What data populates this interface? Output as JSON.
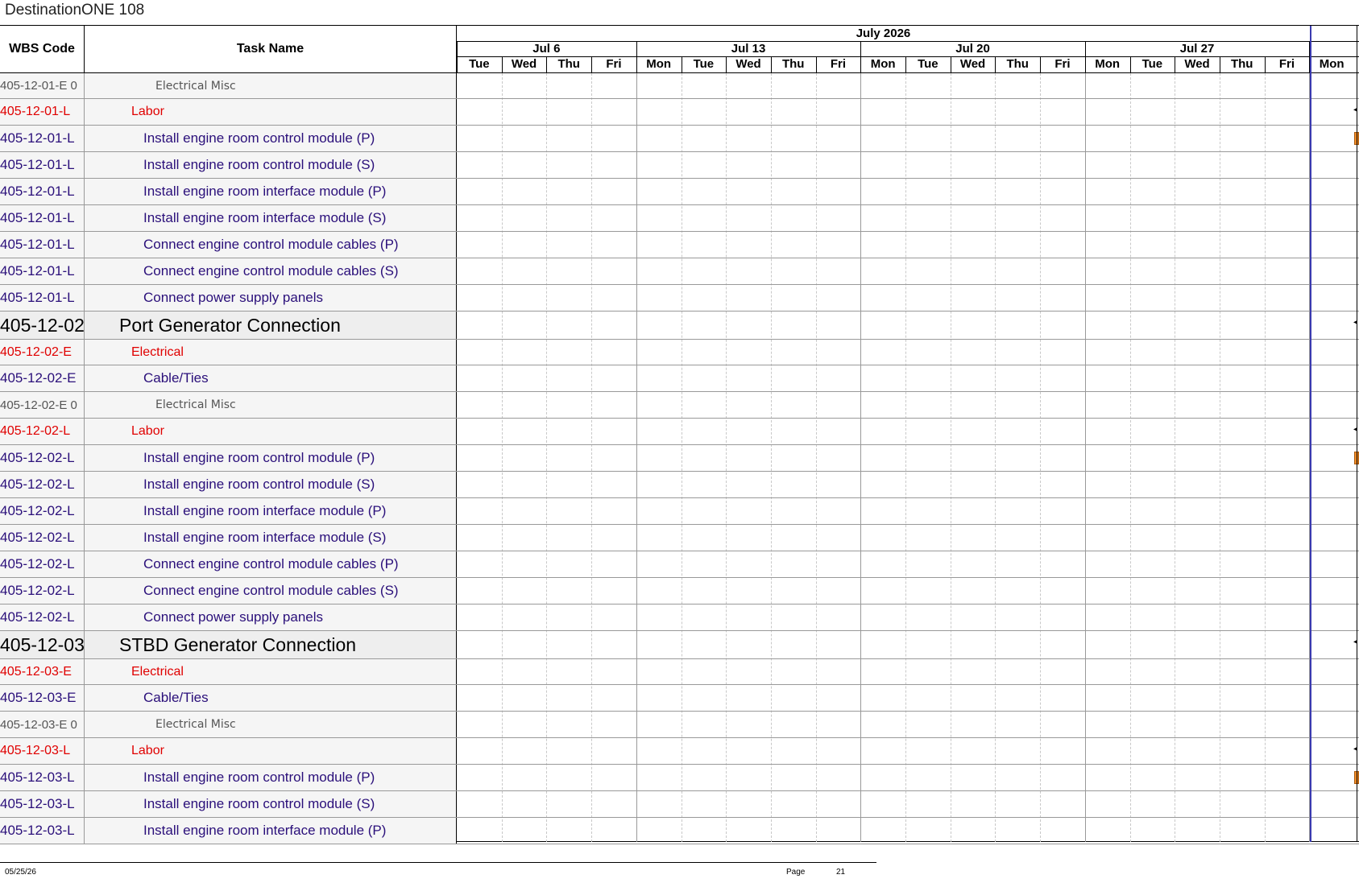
{
  "document": {
    "title": "DestinationONE 108"
  },
  "columns": {
    "wbs": "WBS Code",
    "task": "Task Name"
  },
  "timeline": {
    "month": "July 2026",
    "weeks": [
      "Jul 6",
      "Jul 13",
      "Jul 20",
      "Jul 27"
    ],
    "days": [
      "Tue",
      "Wed",
      "Thu",
      "Fri",
      "Mon",
      "Tue",
      "Wed",
      "Thu",
      "Fri",
      "Mon",
      "Tue",
      "Wed",
      "Thu",
      "Fri",
      "Mon",
      "Tue",
      "Wed",
      "Thu",
      "Fri",
      "Mon"
    ]
  },
  "rows": [
    {
      "wbs": "405-12-01-E 0",
      "task": "Electrical Misc",
      "type": "misc"
    },
    {
      "wbs": "405-12-01-L",
      "task": "Labor",
      "type": "sect"
    },
    {
      "wbs": "405-12-01-L",
      "task": "Install engine room control module (P)",
      "type": "item"
    },
    {
      "wbs": "405-12-01-L",
      "task": "Install engine room control module (S)",
      "type": "item"
    },
    {
      "wbs": "405-12-01-L",
      "task": "Install engine room interface module (P)",
      "type": "item"
    },
    {
      "wbs": "405-12-01-L",
      "task": "Install engine room interface module (S)",
      "type": "item"
    },
    {
      "wbs": "405-12-01-L",
      "task": "Connect engine control module cables (P)",
      "type": "item"
    },
    {
      "wbs": "405-12-01-L",
      "task": "Connect engine control module cables (S)",
      "type": "item"
    },
    {
      "wbs": "405-12-01-L",
      "task": "Connect power supply panels",
      "type": "item"
    },
    {
      "wbs": "405-12-02",
      "task": "Port Generator Connection",
      "type": "group"
    },
    {
      "wbs": "405-12-02-E",
      "task": "Electrical",
      "type": "sect"
    },
    {
      "wbs": "405-12-02-E",
      "task": "Cable/Ties",
      "type": "item"
    },
    {
      "wbs": "405-12-02-E 0",
      "task": "Electrical Misc",
      "type": "misc"
    },
    {
      "wbs": "405-12-02-L",
      "task": "Labor",
      "type": "sect"
    },
    {
      "wbs": "405-12-02-L",
      "task": "Install engine room control module (P)",
      "type": "item"
    },
    {
      "wbs": "405-12-02-L",
      "task": "Install engine room control module (S)",
      "type": "item"
    },
    {
      "wbs": "405-12-02-L",
      "task": "Install engine room interface module (P)",
      "type": "item"
    },
    {
      "wbs": "405-12-02-L",
      "task": "Install engine room interface module (S)",
      "type": "item"
    },
    {
      "wbs": "405-12-02-L",
      "task": "Connect engine control module cables (P)",
      "type": "item"
    },
    {
      "wbs": "405-12-02-L",
      "task": "Connect engine control module cables (S)",
      "type": "item"
    },
    {
      "wbs": "405-12-02-L",
      "task": "Connect power supply panels",
      "type": "item"
    },
    {
      "wbs": "405-12-03",
      "task": "STBD Generator Connection",
      "type": "group"
    },
    {
      "wbs": "405-12-03-E",
      "task": "Electrical",
      "type": "sect"
    },
    {
      "wbs": "405-12-03-E",
      "task": "Cable/Ties",
      "type": "item"
    },
    {
      "wbs": "405-12-03-E 0",
      "task": "Electrical Misc",
      "type": "misc"
    },
    {
      "wbs": "405-12-03-L",
      "task": "Labor",
      "type": "sect"
    },
    {
      "wbs": "405-12-03-L",
      "task": "Install engine room control module (P)",
      "type": "item"
    },
    {
      "wbs": "405-12-03-L",
      "task": "Install engine room control module (S)",
      "type": "item"
    },
    {
      "wbs": "405-12-03-L",
      "task": "Install engine room interface module (P)",
      "type": "item"
    }
  ],
  "footer": {
    "date": "05/25/26",
    "page_label": "Page",
    "page_number": "21"
  },
  "colors": {
    "section_red": "#e00000",
    "item_purple": "#2a0f7a",
    "bar_orange": "#f08a24",
    "today_blue": "#3a3ab0"
  }
}
